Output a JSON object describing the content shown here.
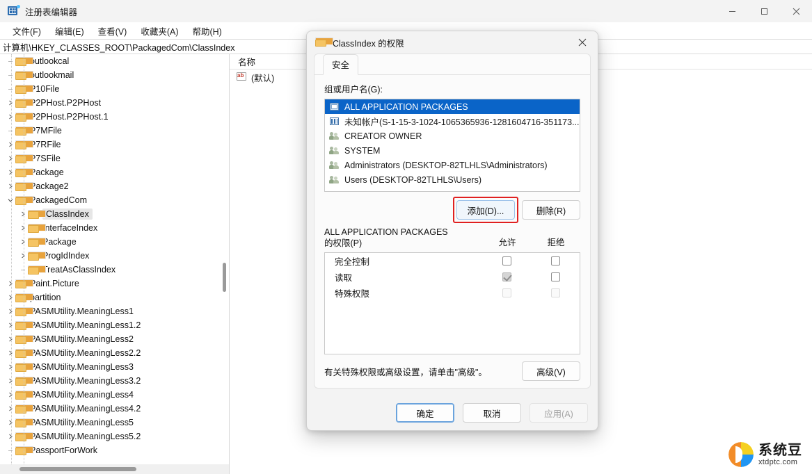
{
  "window": {
    "title": "注册表编辑器",
    "icon": "registry-editor-icon",
    "controls": {
      "minimize": "minimize-icon",
      "maximize": "maximize-icon",
      "close": "close-icon"
    }
  },
  "menubar": {
    "items": [
      {
        "label": "文件(F)"
      },
      {
        "label": "编辑(E)"
      },
      {
        "label": "查看(V)"
      },
      {
        "label": "收藏夹(A)"
      },
      {
        "label": "帮助(H)"
      }
    ]
  },
  "address": {
    "path": "计算机\\HKEY_CLASSES_ROOT\\PackagedCom\\ClassIndex"
  },
  "tree": {
    "items": [
      {
        "label": "outlookcal",
        "indent": 1,
        "expander": "none",
        "selected": false
      },
      {
        "label": "outlookmail",
        "indent": 1,
        "expander": "none",
        "selected": false
      },
      {
        "label": "P10File",
        "indent": 1,
        "expander": "none",
        "selected": false
      },
      {
        "label": "P2PHost.P2PHost",
        "indent": 1,
        "expander": "collapsed",
        "selected": false
      },
      {
        "label": "P2PHost.P2PHost.1",
        "indent": 1,
        "expander": "collapsed",
        "selected": false
      },
      {
        "label": "P7MFile",
        "indent": 1,
        "expander": "none",
        "selected": false
      },
      {
        "label": "P7RFile",
        "indent": 1,
        "expander": "collapsed",
        "selected": false
      },
      {
        "label": "P7SFile",
        "indent": 1,
        "expander": "collapsed",
        "selected": false
      },
      {
        "label": "Package",
        "indent": 1,
        "expander": "collapsed",
        "selected": false
      },
      {
        "label": "Package2",
        "indent": 1,
        "expander": "collapsed",
        "selected": false
      },
      {
        "label": "PackagedCom",
        "indent": 1,
        "expander": "expanded",
        "selected": false
      },
      {
        "label": "ClassIndex",
        "indent": 2,
        "expander": "collapsed",
        "selected": true
      },
      {
        "label": "InterfaceIndex",
        "indent": 2,
        "expander": "collapsed",
        "selected": false
      },
      {
        "label": "Package",
        "indent": 2,
        "expander": "collapsed",
        "selected": false
      },
      {
        "label": "ProgIdIndex",
        "indent": 2,
        "expander": "collapsed",
        "selected": false
      },
      {
        "label": "TreatAsClassIndex",
        "indent": 2,
        "expander": "none",
        "selected": false
      },
      {
        "label": "Paint.Picture",
        "indent": 1,
        "expander": "collapsed",
        "selected": false
      },
      {
        "label": "partition",
        "indent": 1,
        "expander": "collapsed",
        "selected": false
      },
      {
        "label": "PASMUtility.MeaningLess1",
        "indent": 1,
        "expander": "collapsed",
        "selected": false
      },
      {
        "label": "PASMUtility.MeaningLess1.2",
        "indent": 1,
        "expander": "collapsed",
        "selected": false
      },
      {
        "label": "PASMUtility.MeaningLess2",
        "indent": 1,
        "expander": "collapsed",
        "selected": false
      },
      {
        "label": "PASMUtility.MeaningLess2.2",
        "indent": 1,
        "expander": "collapsed",
        "selected": false
      },
      {
        "label": "PASMUtility.MeaningLess3",
        "indent": 1,
        "expander": "collapsed",
        "selected": false
      },
      {
        "label": "PASMUtility.MeaningLess3.2",
        "indent": 1,
        "expander": "collapsed",
        "selected": false
      },
      {
        "label": "PASMUtility.MeaningLess4",
        "indent": 1,
        "expander": "collapsed",
        "selected": false
      },
      {
        "label": "PASMUtility.MeaningLess4.2",
        "indent": 1,
        "expander": "collapsed",
        "selected": false
      },
      {
        "label": "PASMUtility.MeaningLess5",
        "indent": 1,
        "expander": "collapsed",
        "selected": false
      },
      {
        "label": "PASMUtility.MeaningLess5.2",
        "indent": 1,
        "expander": "collapsed",
        "selected": false
      },
      {
        "label": "PassportForWork",
        "indent": 1,
        "expander": "none",
        "selected": false
      }
    ]
  },
  "values": {
    "column_header": "名称",
    "rows": [
      {
        "name": "(默认)",
        "icon": "ab-string-icon"
      }
    ]
  },
  "dialog": {
    "title": "ClassIndex 的权限",
    "icon": "folder-icon",
    "close_icon": "close-icon",
    "tabs": [
      {
        "label": "安全",
        "active": true
      }
    ],
    "group_label": "组或用户名(G):",
    "group_label_accel": "G",
    "users": [
      {
        "name": "ALL APPLICATION PACKAGES",
        "icon": "app-package-icon",
        "selected": true
      },
      {
        "name": "未知帐户(S-1-15-3-1024-1065365936-1281604716-351173...",
        "icon": "unknown-account-icon",
        "selected": false
      },
      {
        "name": "CREATOR OWNER",
        "icon": "group-icon",
        "selected": false
      },
      {
        "name": "SYSTEM",
        "icon": "group-icon",
        "selected": false
      },
      {
        "name": "Administrators (DESKTOP-82TLHLS\\Administrators)",
        "icon": "group-icon",
        "selected": false
      },
      {
        "name": "Users (DESKTOP-82TLHLS\\Users)",
        "icon": "group-icon",
        "selected": false
      }
    ],
    "add_button": "添加(D)...",
    "remove_button": "删除(R)",
    "permissions_title_line1": "ALL APPLICATION PACKAGES",
    "permissions_title_line2": "的权限(P)",
    "allow_header": "允许",
    "deny_header": "拒绝",
    "permissions": [
      {
        "name": "完全控制",
        "allow": "unchecked",
        "deny": "unchecked"
      },
      {
        "name": "读取",
        "allow": "checked-disabled",
        "deny": "unchecked"
      },
      {
        "name": "特殊权限",
        "allow": "disabled",
        "deny": "disabled"
      }
    ],
    "advanced_note": "有关特殊权限或高级设置，请单击\"高级\"。",
    "advanced_button": "高级(V)",
    "ok_button": "确定",
    "cancel_button": "取消",
    "apply_button": "应用(A)",
    "highlight_color": "#e02020"
  },
  "watermark": {
    "cn": "系统豆",
    "en": "xtdptc.com"
  }
}
